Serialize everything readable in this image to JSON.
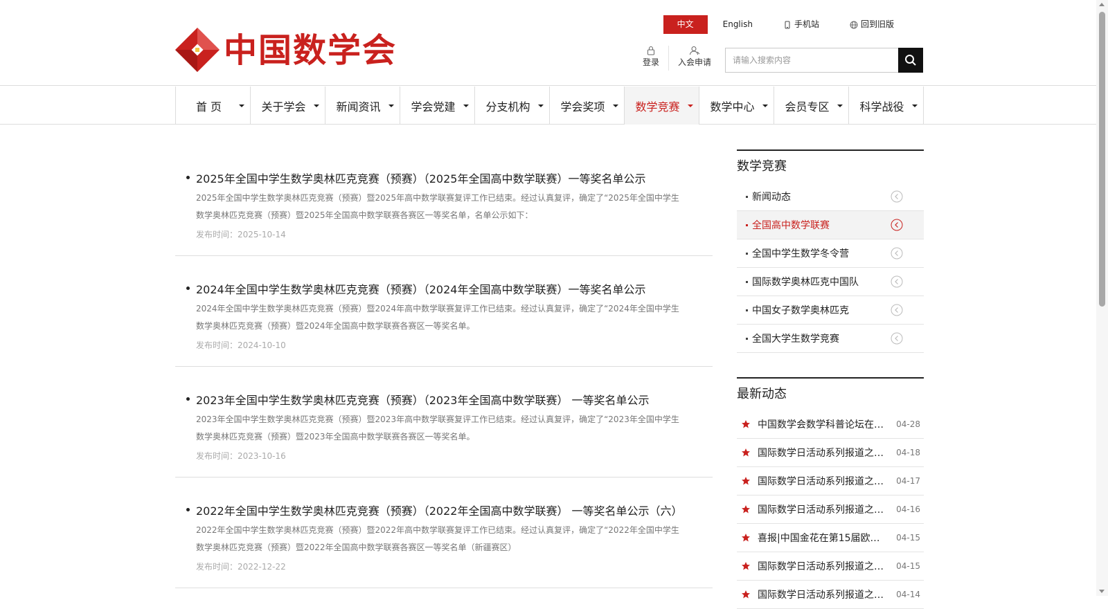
{
  "brand": {
    "name": "中国数学会",
    "accent_color": "#c9211e"
  },
  "lang_bar": {
    "chinese": "中文",
    "english": "English",
    "mobile": "手机站",
    "old_version": "回到旧版"
  },
  "user": {
    "login": "登录",
    "join": "入会申请"
  },
  "search": {
    "placeholder": "请输入搜索内容",
    "icon": "search-icon"
  },
  "nav": {
    "items": [
      {
        "label": "首 页"
      },
      {
        "label": "关于学会"
      },
      {
        "label": "新闻资讯"
      },
      {
        "label": "学会党建"
      },
      {
        "label": "分支机构"
      },
      {
        "label": "学会奖项"
      },
      {
        "label": "数学竞赛"
      },
      {
        "label": "数学中心"
      },
      {
        "label": "会员专区"
      },
      {
        "label": "科学战役"
      }
    ],
    "active_index": 6
  },
  "articles": [
    {
      "title": "2025年全国中学生数学奥林匹克竞赛（预赛）（2025年全国高中数学联赛）一等奖名单公示",
      "summary": "2025年全国中学生数学奥林匹克竞赛（预赛）暨2025年高中数学联赛复评工作已结束。经过认真复评，确定了“2025年全国中学生数学奥林匹克竞赛（预赛）暨2025年全国高中数学联赛各赛区一等奖名单，名单公示如下：",
      "date": "发布时间：2025-10-14"
    },
    {
      "title": "2024年全国中学生数学奥林匹克竞赛（预赛）（2024年全国高中数学联赛）一等奖名单公示",
      "summary": "2024年全国中学生数学奥林匹克竞赛（预赛）暨2024年高中数学联赛复评工作已结束。经过认真复评，确定了“2024年全国中学生数学奥林匹克竞赛（预赛）暨2024年全国高中数学联赛各赛区一等奖名单。",
      "date": "发布时间：2024-10-10"
    },
    {
      "title": "2023年全国中学生数学奥林匹克竞赛（预赛）（2023年全国高中数学联赛） 一等奖名单公示",
      "summary": "2023年全国中学生数学奥林匹克竞赛（预赛）暨2023年高中数学联赛复评工作已结束。经过认真复评，确定了“2023年全国中学生数学奥林匹克竞赛（预赛）暨2023年全国高中数学联赛各赛区一等奖名单。",
      "date": "发布时间：2023-10-16"
    },
    {
      "title": "2022年全国中学生数学奥林匹克竞赛（预赛）（2022年全国高中数学联赛） 一等奖名单公示（六）",
      "summary": "2022年全国中学生数学奥林匹克竞赛（预赛）暨2022年高中数学联赛复评工作已结束。经过认真复评，确定了“2022年全国中学生数学奥林匹克竞赛（预赛）暨2022年全国高中数学联赛各赛区一等奖名单（新疆赛区）",
      "date": "发布时间：2022-12-22"
    }
  ],
  "sidebar": {
    "title": "数学竞赛",
    "items": [
      {
        "label": "新闻动态"
      },
      {
        "label": "全国高中数学联赛"
      },
      {
        "label": "全国中学生数学冬令营"
      },
      {
        "label": "国际数学奥林匹克中国队"
      },
      {
        "label": "中国女子数学奥林匹克"
      },
      {
        "label": "全国大学生数学竞赛"
      }
    ],
    "active_index": 1
  },
  "latest": {
    "title": "最新动态",
    "items": [
      {
        "text": "中国数学会数学科普论坛在…",
        "date": "04-28"
      },
      {
        "text": "国际数学日活动系列报道之…",
        "date": "04-18"
      },
      {
        "text": "国际数学日活动系列报道之…",
        "date": "04-17"
      },
      {
        "text": "国际数学日活动系列报道之…",
        "date": "04-16"
      },
      {
        "text": "喜报|中国金花在第15届欧洲…",
        "date": "04-15"
      },
      {
        "text": "国际数学日活动系列报道之…",
        "date": "04-15"
      },
      {
        "text": "国际数学日活动系列报道之…",
        "date": "04-14"
      }
    ]
  }
}
